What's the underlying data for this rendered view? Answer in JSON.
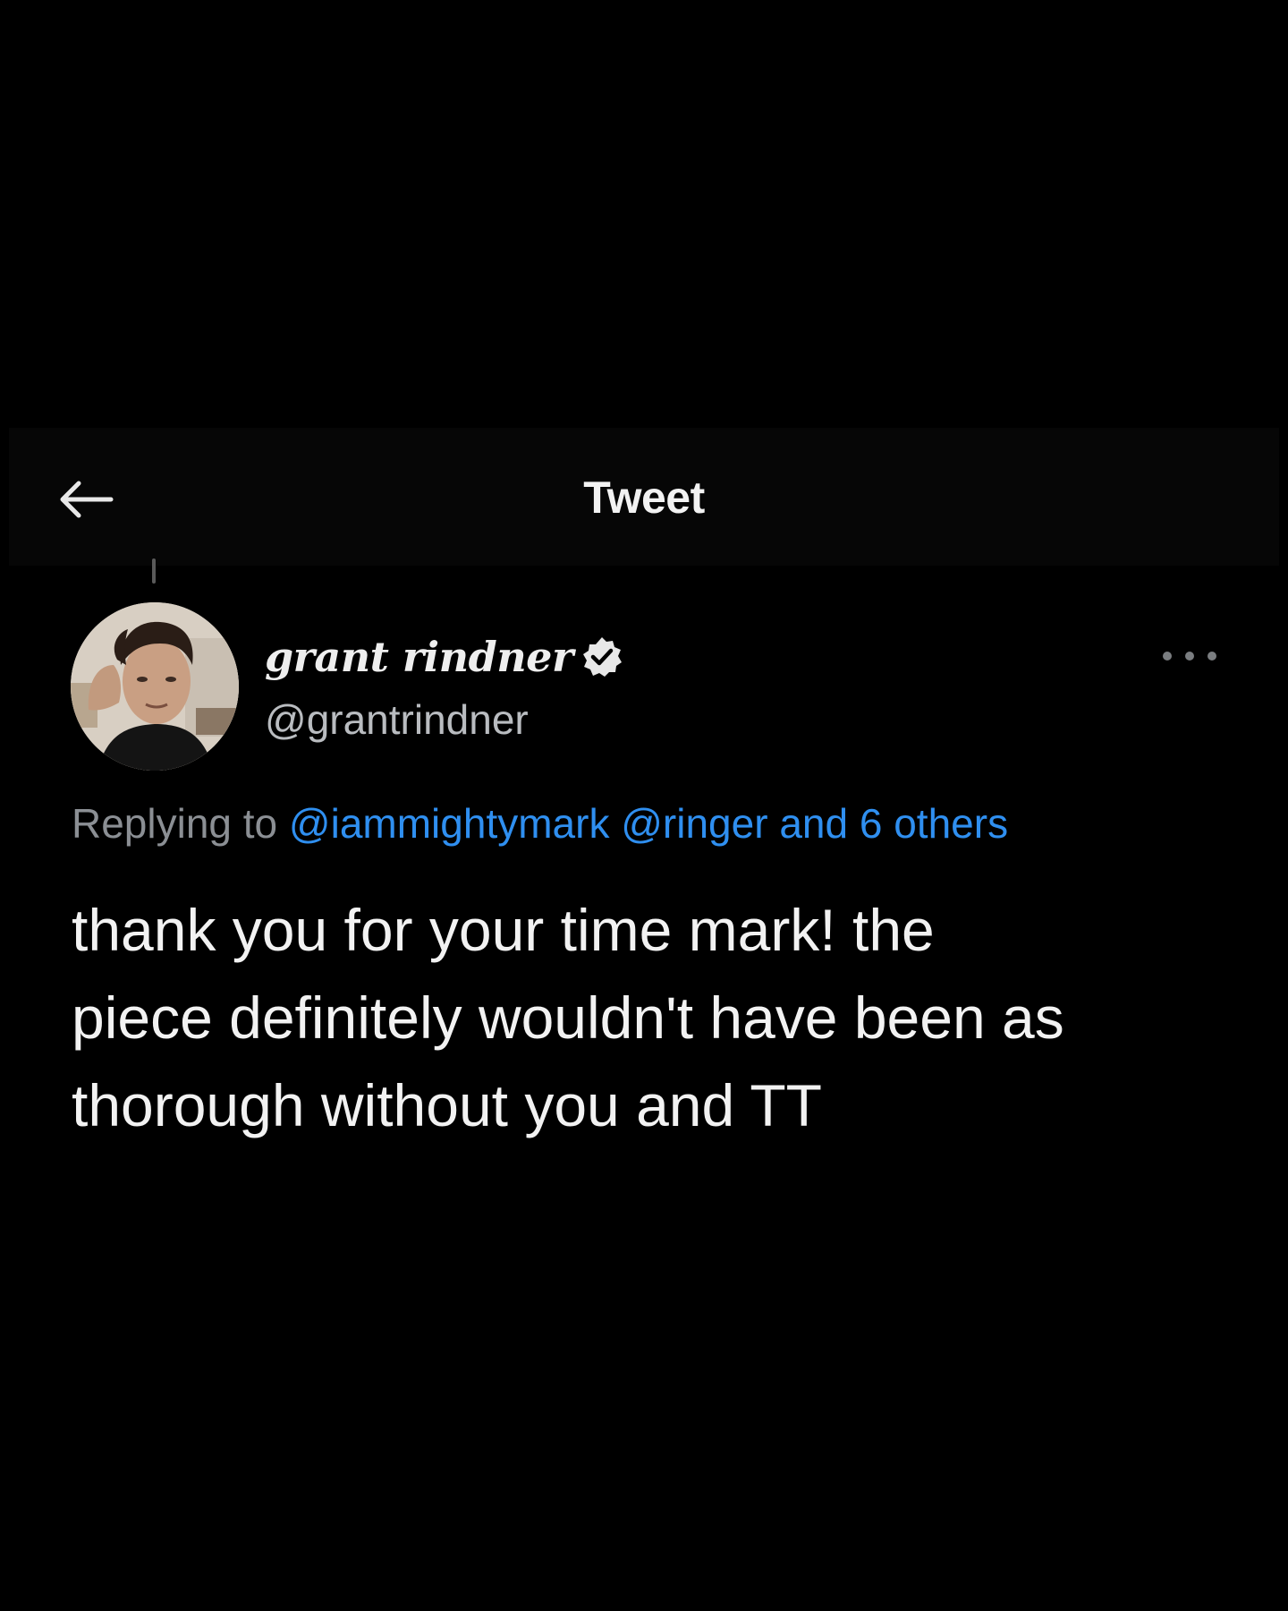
{
  "header": {
    "title": "Tweet",
    "back_icon": "arrow-left-icon"
  },
  "author": {
    "display_name": "grant rindner",
    "handle": "@grantrindner",
    "verified": true,
    "avatar_icon": "avatar-photo",
    "more_icon": "more-horizontal-icon"
  },
  "reply": {
    "prefix": "Replying to",
    "mention_1": "@iammightymark",
    "mention_2": "@ringer",
    "others": "and 6 others"
  },
  "tweet": {
    "line_1": "thank you for your time mark! the",
    "line_2": "piece definitely wouldn't have been as",
    "line_3": "thorough without you and TT"
  },
  "colors": {
    "background": "#000000",
    "text": "#f2f2f2",
    "secondary_text": "#8b8f94",
    "link": "#2f8ff0"
  }
}
